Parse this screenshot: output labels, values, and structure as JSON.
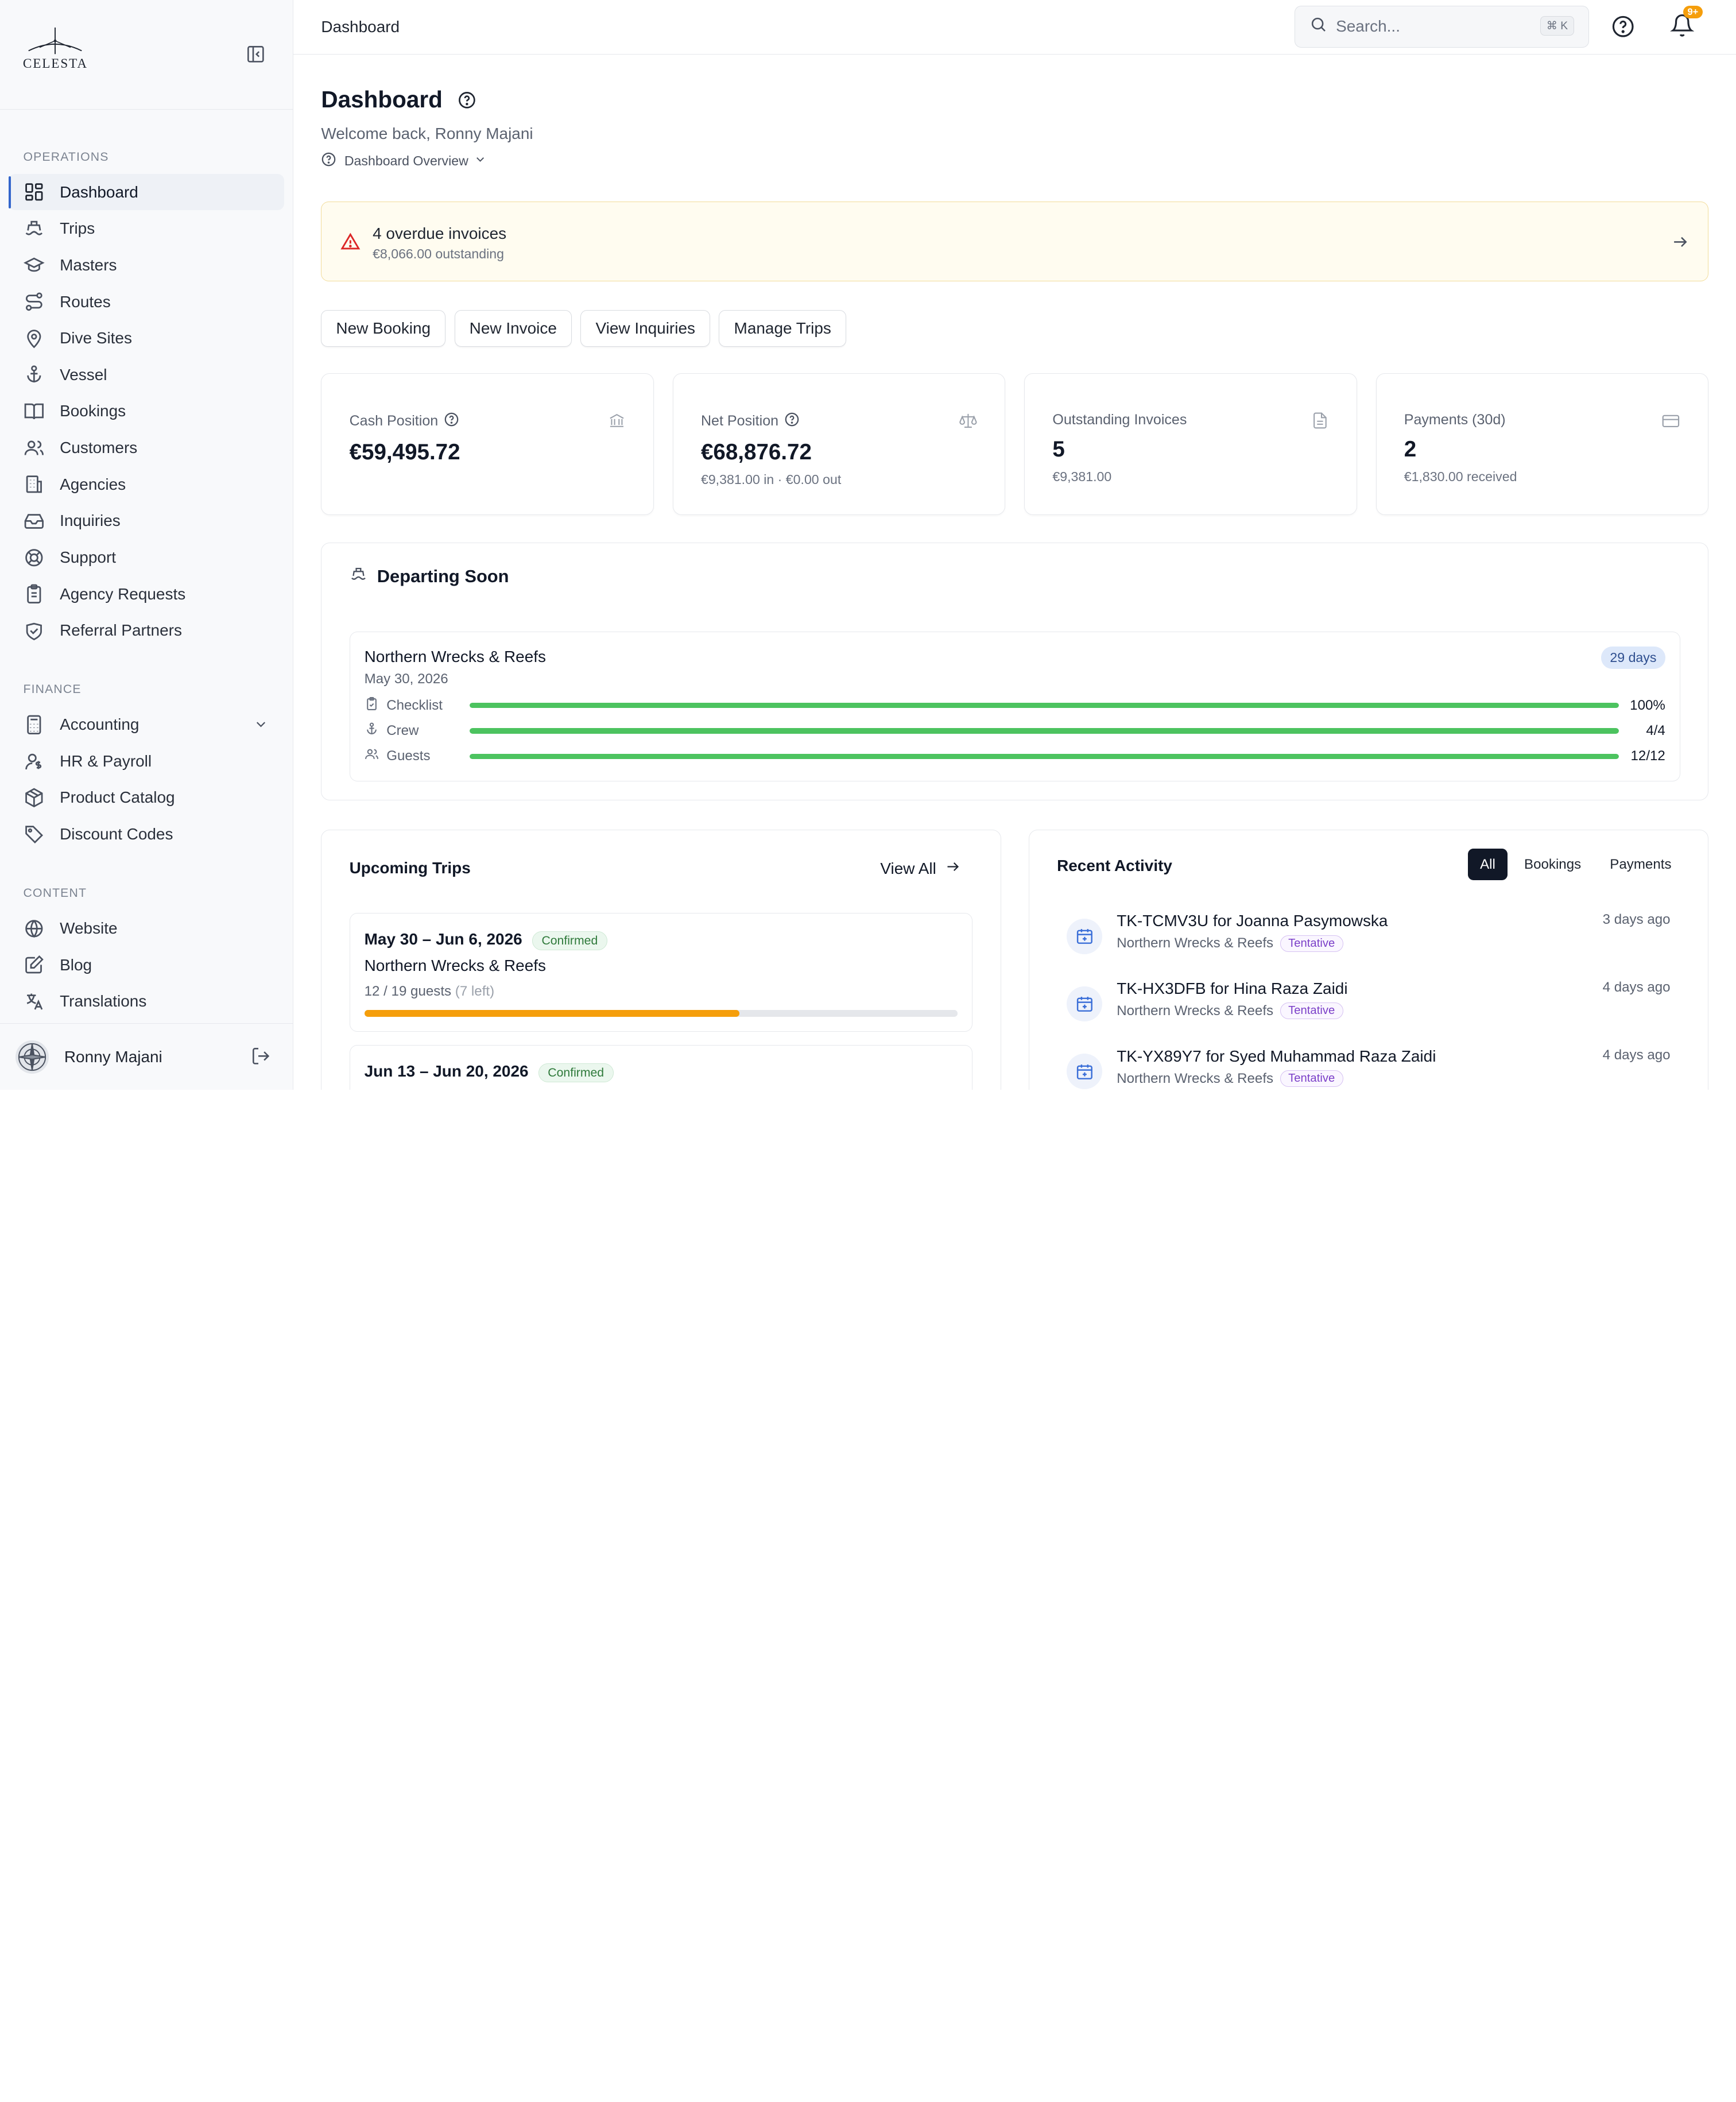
{
  "brand": {
    "name": "CELESTA"
  },
  "sidebar": {
    "sections": [
      {
        "label": "OPERATIONS",
        "items": [
          {
            "label": "Dashboard",
            "icon": "grid-icon"
          },
          {
            "label": "Trips",
            "icon": "ship-icon"
          },
          {
            "label": "Masters",
            "icon": "graduation-cap-icon"
          },
          {
            "label": "Routes",
            "icon": "route-icon"
          },
          {
            "label": "Dive Sites",
            "icon": "map-pin-icon"
          },
          {
            "label": "Vessel",
            "icon": "anchor-icon"
          },
          {
            "label": "Bookings",
            "icon": "book-open-icon"
          },
          {
            "label": "Customers",
            "icon": "users-icon"
          },
          {
            "label": "Agencies",
            "icon": "building-icon"
          },
          {
            "label": "Inquiries",
            "icon": "inbox-icon"
          },
          {
            "label": "Support",
            "icon": "life-buoy-icon"
          },
          {
            "label": "Agency Requests",
            "icon": "clipboard-list-icon"
          },
          {
            "label": "Referral Partners",
            "icon": "handshake-icon"
          }
        ]
      },
      {
        "label": "FINANCE",
        "items": [
          {
            "label": "Accounting",
            "icon": "calculator-icon"
          },
          {
            "label": "HR & Payroll",
            "icon": "user-dollar-icon"
          },
          {
            "label": "Product Catalog",
            "icon": "package-icon"
          },
          {
            "label": "Discount Codes",
            "icon": "tag-icon"
          }
        ]
      },
      {
        "label": "CONTENT",
        "items": [
          {
            "label": "Website",
            "icon": "globe-icon"
          },
          {
            "label": "Blog",
            "icon": "edit-note-icon"
          },
          {
            "label": "Translations",
            "icon": "languages-icon"
          }
        ]
      }
    ],
    "user": {
      "name": "Ronny Majani"
    }
  },
  "topbar": {
    "title": "Dashboard",
    "search_placeholder": "Search...",
    "shortcut": "⌘ K",
    "notifications_badge": "9+"
  },
  "page": {
    "title": "Dashboard",
    "welcome": "Welcome back, Ronny Majani",
    "overview_label": "Dashboard Overview"
  },
  "alert": {
    "title": "4 overdue invoices",
    "subtitle": "€8,066.00 outstanding",
    "color": "#dc2626"
  },
  "actions": [
    "New Booking",
    "New Invoice",
    "View Inquiries",
    "Manage Trips"
  ],
  "stats": [
    {
      "label": "Cash Position",
      "value": "€59,495.72",
      "sub": "",
      "icon": "bank-icon",
      "has_help": true
    },
    {
      "label": "Net Position",
      "value": "€68,876.72",
      "sub": "€9,381.00 in · €0.00 out",
      "icon": "scale-icon",
      "has_help": true
    },
    {
      "label": "Outstanding Invoices",
      "value": "5",
      "sub": "€9,381.00",
      "icon": "file-icon",
      "has_help": false
    },
    {
      "label": "Payments (30d)",
      "value": "2",
      "sub": "€1,830.00 received",
      "icon": "credit-card-icon",
      "has_help": false
    }
  ],
  "departing": {
    "title": "Departing Soon",
    "trip": {
      "name": "Northern Wrecks & Reefs",
      "date": "May 30, 2026",
      "days": "29 days",
      "rows": [
        {
          "label": "Checklist",
          "value": "100%",
          "progress": 1.0,
          "icon": "clipboard-check-icon"
        },
        {
          "label": "Crew",
          "value": "4/4",
          "progress": 1.0,
          "icon": "anchor-icon"
        },
        {
          "label": "Guests",
          "value": "12/12",
          "progress": 1.0,
          "icon": "users-icon"
        }
      ]
    },
    "bar_color": "#4cc35f"
  },
  "upcoming": {
    "title": "Upcoming Trips",
    "view_all": "View All",
    "trips": [
      {
        "dates": "May 30 – Jun 6, 2026",
        "status": "Confirmed",
        "name": "Northern Wrecks & Reefs",
        "guests": "12 / 19 guests",
        "left": "(7 left)",
        "fill": 0.632
      },
      {
        "dates": "Jun 13 – Jun 20, 2026",
        "status": "Confirmed",
        "name": "",
        "guests": "",
        "left": "",
        "fill": 0
      }
    ]
  },
  "activity": {
    "title": "Recent Activity",
    "tabs": [
      "All",
      "Bookings",
      "Payments"
    ],
    "items": [
      {
        "title": "TK-TCMV3U for Joanna Pasymowska",
        "trip": "Northern Wrecks & Reefs",
        "status": "Tentative",
        "time": "3 days ago"
      },
      {
        "title": "TK-HX3DFB for Hina Raza Zaidi",
        "trip": "Northern Wrecks & Reefs",
        "status": "Tentative",
        "time": "4 days ago"
      },
      {
        "title": "TK-YX89Y7 for Syed Muhammad Raza Zaidi",
        "trip": "Northern Wrecks & Reefs",
        "status": "Tentative",
        "time": "4 days ago"
      }
    ]
  }
}
